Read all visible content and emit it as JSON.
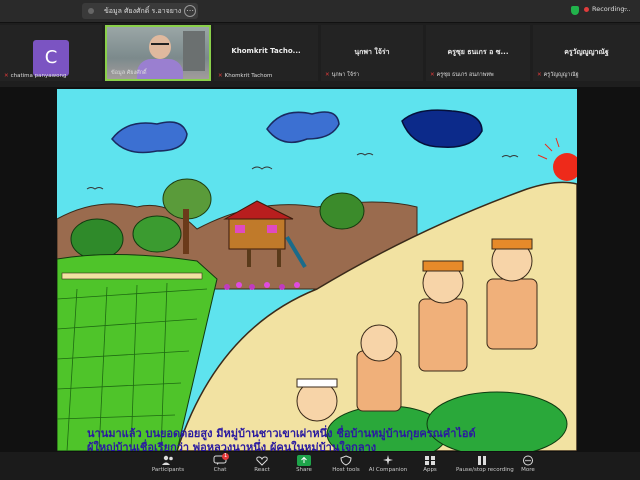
{
  "window": {
    "tab_title": "ข้อมูล ศัยงศักดิ์ ร.อาจยาง",
    "recording_label": "Recording..."
  },
  "participants": [
    {
      "display": "C",
      "label": "chatima panyawong",
      "muted": true
    },
    {
      "display": "",
      "label": "ข้อมูล ศัยงศักดิ์",
      "muted": false
    },
    {
      "display": "Khomkrit   Tacho...",
      "label": "Khomkrit  Tachom",
      "muted": true
    },
    {
      "display": "นุกพา ใจ้ร่า",
      "label": "นุกพา ใจ้ร่า",
      "muted": true
    },
    {
      "display": "ครูซุย ธนเกร อ ซ...",
      "label": "ครูซุย ธนเกร อนภาพทพ",
      "muted": true
    },
    {
      "display": "ครูวัญญูญาณัฐ",
      "label": "ครูวัญญูญาณัฐ",
      "muted": true
    }
  ],
  "slide": {
    "caption_line1": "นานมาแล้ว บนยอดดอยสูง มีหมู่บ้านชาวเขาเผ่าหนึ่ง ชื่อบ้านหมู่บ้านกุยครณคำไอด์",
    "caption_line2": "ผู้ใหญ่บ้านเชื่อเรียกว่า พ่อหลวงนาหนึ่ง ผู้คนในหมู่บ้านใจกลาง"
  },
  "toolbar": {
    "participants": "Participants",
    "chat": "Chat",
    "chat_badge": "1",
    "react": "React",
    "share": "Share",
    "host_tools": "Host tools",
    "ai_companion": "AI Companion",
    "apps": "Apps",
    "pause_record": "Pause/stop recording",
    "more": "More"
  },
  "colors": {
    "sky": "#5ee3ee",
    "hill": "#f2e2a2",
    "field": "#4fc42a",
    "accent_recording": "#e03c3c",
    "active_speaker": "#8ad04a"
  }
}
